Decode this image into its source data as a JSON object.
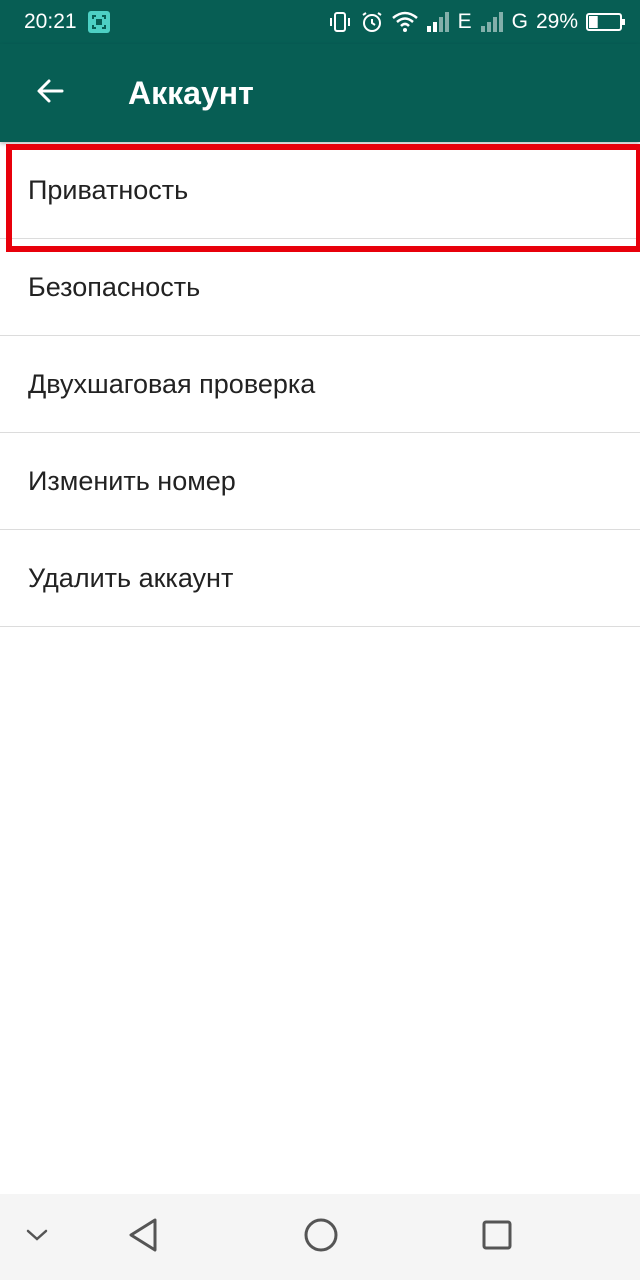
{
  "status_bar": {
    "time": "20:21",
    "network_1": "E",
    "network_2": "G",
    "battery_percent": "29%",
    "battery_level": 0.29,
    "icons": [
      "screenshot-icon",
      "vibrate-icon",
      "alarm-icon",
      "wifi-icon",
      "signal-icon",
      "battery-icon"
    ]
  },
  "app_bar": {
    "title": "Аккаунт",
    "back_icon": "arrow-left-icon"
  },
  "settings": {
    "items": [
      {
        "label": "Приватность",
        "highlighted": true
      },
      {
        "label": "Безопасность"
      },
      {
        "label": "Двухшаговая проверка"
      },
      {
        "label": "Изменить номер"
      },
      {
        "label": "Удалить аккаунт"
      }
    ]
  },
  "nav_bar": {
    "buttons": [
      "chevron-down-icon",
      "back-triangle-icon",
      "home-circle-icon",
      "recents-square-icon"
    ]
  },
  "colors": {
    "primary": "#075e54",
    "highlight": "#e8000b"
  }
}
